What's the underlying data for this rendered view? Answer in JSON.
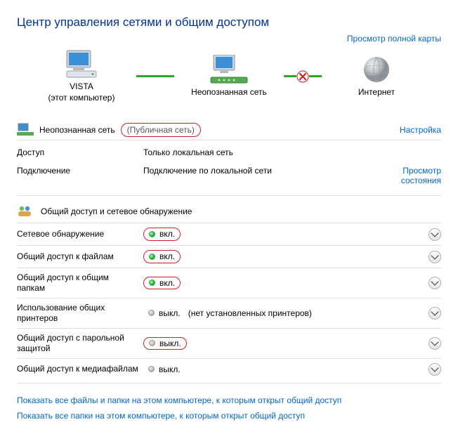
{
  "title": "Центр управления сетями и общим доступом",
  "map_link": "Просмотр полной карты",
  "nodes": {
    "computer": {
      "name": "VISTA",
      "caption": "(этот компьютер)"
    },
    "network": {
      "name": "Неопознанная сеть"
    },
    "internet": {
      "name": "Интернет"
    }
  },
  "net_section": {
    "name": "Неопознанная сеть",
    "type": "(Публичная сеть)",
    "configure": "Настройка",
    "rows": {
      "access_label": "Доступ",
      "access_value": "Только локальная сеть",
      "conn_label": "Подключение",
      "conn_value": "Подключение по локальной сети",
      "view_status": "Просмотр состояния"
    }
  },
  "sharing_section": {
    "title": "Общий доступ и сетевое обнаружение",
    "items": [
      {
        "label": "Сетевое обнаружение",
        "status": "вкл.",
        "on": true,
        "outlined": true,
        "extra": ""
      },
      {
        "label": "Общий доступ к файлам",
        "status": "вкл.",
        "on": true,
        "outlined": true,
        "extra": ""
      },
      {
        "label": "Общий доступ к общим папкам",
        "status": "вкл.",
        "on": true,
        "outlined": true,
        "extra": ""
      },
      {
        "label": "Использование общих принтеров",
        "status": "выкл.",
        "on": false,
        "outlined": false,
        "extra": "(нет установленных принтеров)"
      },
      {
        "label": "Общий доступ с парольной защитой",
        "status": "выкл.",
        "on": false,
        "outlined": true,
        "extra": ""
      },
      {
        "label": "Общий доступ к медиафайлам",
        "status": "выкл.",
        "on": false,
        "outlined": false,
        "extra": ""
      }
    ]
  },
  "bottom_links": [
    "Показать все файлы и папки на этом компьютере, к которым открыт общий доступ",
    "Показать все папки на этом компьютере, к которым открыт общий доступ"
  ]
}
